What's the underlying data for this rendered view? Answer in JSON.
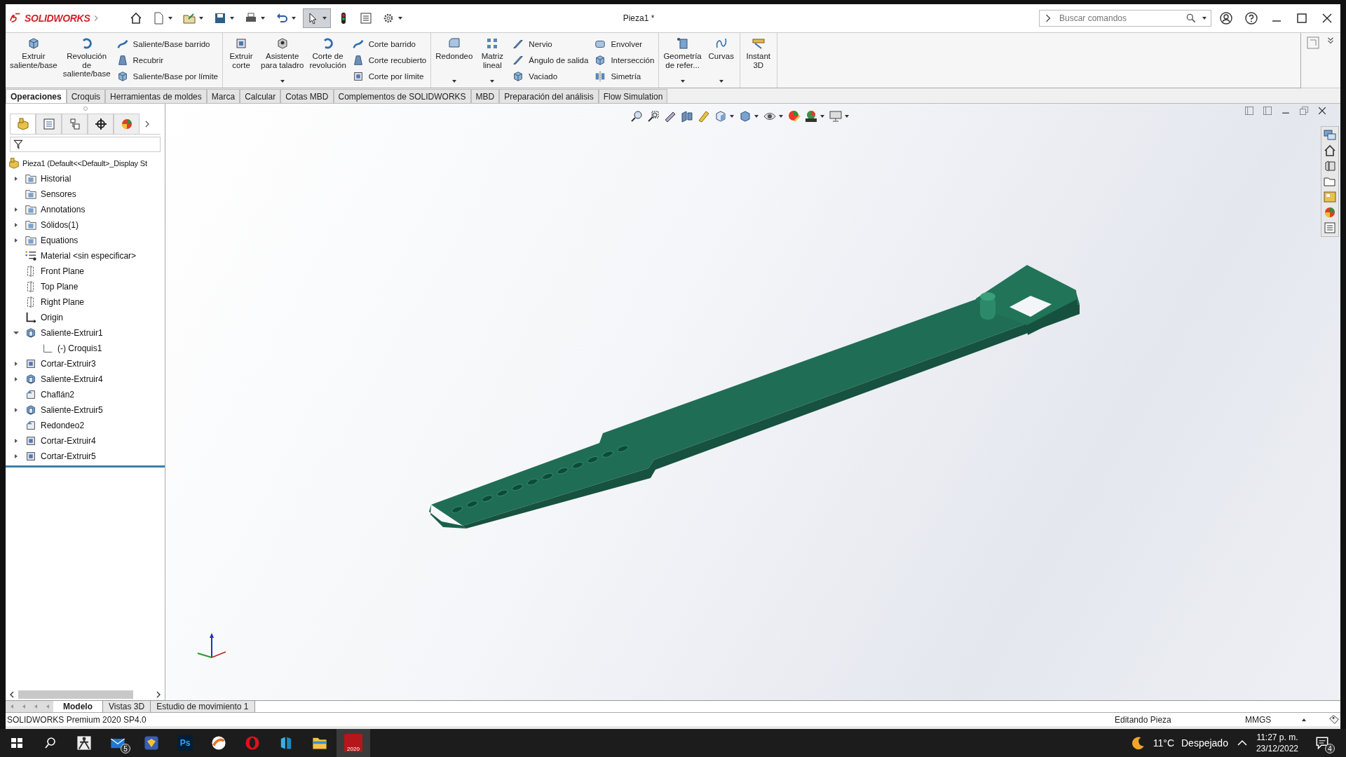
{
  "app": {
    "logo": "SOLIDWORKS"
  },
  "window": {
    "title": "Pieza1 *"
  },
  "quick_access": [
    {
      "dropdown": false,
      "pressed": false
    },
    {
      "dropdown": true,
      "pressed": false
    },
    {
      "dropdown": true,
      "pressed": false
    },
    {
      "dropdown": true,
      "pressed": false
    },
    {
      "dropdown": true,
      "pressed": false
    },
    {
      "dropdown": true,
      "pressed": false
    },
    {
      "dropdown": true,
      "pressed": true
    },
    {
      "dropdown": false,
      "pressed": false
    },
    {
      "dropdown": false,
      "pressed": false
    },
    {
      "dropdown": true,
      "pressed": false
    }
  ],
  "search": {
    "placeholder": "Buscar comandos"
  },
  "ribbon": {
    "groups": [
      {
        "items": [
          {
            "kind": "large",
            "label": "Extruir\nsaliente/base",
            "dropdown": false
          },
          {
            "kind": "large",
            "label": "Revolución\nde\nsaliente/base",
            "dropdown": false
          },
          {
            "kind": "stack",
            "entries": [
              "Saliente/Base barrido",
              "Recubrir",
              "Saliente/Base por límite"
            ]
          }
        ]
      },
      {
        "items": [
          {
            "kind": "large",
            "label": "Extruir\ncorte",
            "dropdown": false
          },
          {
            "kind": "large",
            "label": "Asistente\npara taladro",
            "dropdown": true
          },
          {
            "kind": "large",
            "label": "Corte de\nrevolución",
            "dropdown": false
          },
          {
            "kind": "stack",
            "entries": [
              "Corte barrido",
              "Corte recubierto",
              "Corte por límite"
            ]
          }
        ]
      },
      {
        "items": [
          {
            "kind": "large",
            "label": "Redondeo",
            "dropdown": true
          },
          {
            "kind": "large",
            "label": "Matriz\nlineal",
            "dropdown": true
          },
          {
            "kind": "stack",
            "entries": [
              "Nervio",
              "Ángulo de salida",
              "Vaciado"
            ]
          },
          {
            "kind": "stack",
            "entries": [
              "Envolver",
              "Intersección",
              "Simetría"
            ]
          }
        ]
      },
      {
        "items": [
          {
            "kind": "large",
            "label": "Geometría\nde refer...",
            "dropdown": true
          },
          {
            "kind": "large",
            "label": "Curvas",
            "dropdown": true
          }
        ]
      },
      {
        "items": [
          {
            "kind": "large",
            "label": "Instant\n3D",
            "dropdown": false
          }
        ]
      }
    ]
  },
  "command_tabs": [
    {
      "label": "Operaciones",
      "selected": true
    },
    {
      "label": "Croquis",
      "selected": false
    },
    {
      "label": "Herramientas de moldes",
      "selected": false
    },
    {
      "label": "Marca",
      "selected": false
    },
    {
      "label": "Calcular",
      "selected": false
    },
    {
      "label": "Cotas MBD",
      "selected": false
    },
    {
      "label": "Complementos de SOLIDWORKS",
      "selected": false
    },
    {
      "label": "MBD",
      "selected": false
    },
    {
      "label": "Preparación del análisis",
      "selected": false
    },
    {
      "label": "Flow Simulation",
      "selected": false
    }
  ],
  "feature_tree": {
    "panel_tabs": [
      {
        "selected": true
      },
      {
        "selected": false
      },
      {
        "selected": false
      },
      {
        "selected": false
      },
      {
        "selected": false
      }
    ],
    "root": "Pieza1  (Default<<Default>_Display St",
    "items": [
      {
        "label": "Historial",
        "kind": "folder",
        "expandable": true,
        "expanded": false
      },
      {
        "label": "Sensores",
        "kind": "folder",
        "expandable": false
      },
      {
        "label": "Annotations",
        "kind": "folder",
        "expandable": true,
        "expanded": false
      },
      {
        "label": "Sólidos(1)",
        "kind": "folder",
        "expandable": true,
        "expanded": false
      },
      {
        "label": "Equations",
        "kind": "folder",
        "expandable": true,
        "expanded": false
      },
      {
        "label": "Material <sin especificar>",
        "kind": "material",
        "expandable": false
      },
      {
        "label": "Front Plane",
        "kind": "plane",
        "expandable": false
      },
      {
        "label": "Top Plane",
        "kind": "plane",
        "expandable": false
      },
      {
        "label": "Right Plane",
        "kind": "plane",
        "expandable": false
      },
      {
        "label": "Origin",
        "kind": "origin",
        "expandable": false
      },
      {
        "label": "Saliente-Extruir1",
        "kind": "boss",
        "expandable": true,
        "expanded": true,
        "children": [
          {
            "label": "(-) Croquis1",
            "kind": "sketch",
            "expandable": false
          }
        ]
      },
      {
        "label": "Cortar-Extruir3",
        "kind": "cut",
        "expandable": true,
        "expanded": false
      },
      {
        "label": "Saliente-Extruir4",
        "kind": "boss",
        "expandable": true,
        "expanded": false
      },
      {
        "label": "Chaflán2",
        "kind": "chamfer",
        "expandable": false
      },
      {
        "label": "Saliente-Extruir5",
        "kind": "boss",
        "expandable": true,
        "expanded": false
      },
      {
        "label": "Redondeo2",
        "kind": "chamfer",
        "expandable": false
      },
      {
        "label": "Cortar-Extruir4",
        "kind": "cut",
        "expandable": true,
        "expanded": false
      },
      {
        "label": "Cortar-Extruir5",
        "kind": "cut",
        "expandable": true,
        "expanded": false
      }
    ]
  },
  "view_toolbar": [
    {
      "dropdown": false
    },
    {
      "dropdown": false
    },
    {
      "dropdown": false
    },
    {
      "dropdown": false
    },
    {
      "dropdown": false
    },
    {
      "dropdown": true
    },
    {
      "dropdown": true
    },
    {
      "dropdown": true
    },
    {
      "dropdown": false
    },
    {
      "dropdown": true
    },
    {
      "dropdown": true
    }
  ],
  "model_tabs": [
    {
      "label": "Modelo",
      "selected": true
    },
    {
      "label": "Vistas 3D",
      "selected": false
    },
    {
      "label": "Estudio de movimiento 1",
      "selected": false
    }
  ],
  "status_bar": {
    "product": "SOLIDWORKS Premium 2020 SP4.0",
    "mode": "Editando Pieza",
    "units": "MMGS"
  },
  "taskbar": {
    "apps": [
      {
        "selected": false
      },
      {
        "badge": "5",
        "selected": false
      },
      {
        "selected": false
      },
      {
        "label": "Ps",
        "selected": false
      },
      {
        "selected": false
      },
      {
        "selected": false
      },
      {
        "selected": false
      },
      {
        "selected": false
      },
      {
        "label": "2020",
        "selected": true
      }
    ],
    "temperature": "11°C",
    "weather": "Despejado",
    "time": "11:27 p. m.",
    "date": "23/12/2022",
    "notifications": "4"
  }
}
